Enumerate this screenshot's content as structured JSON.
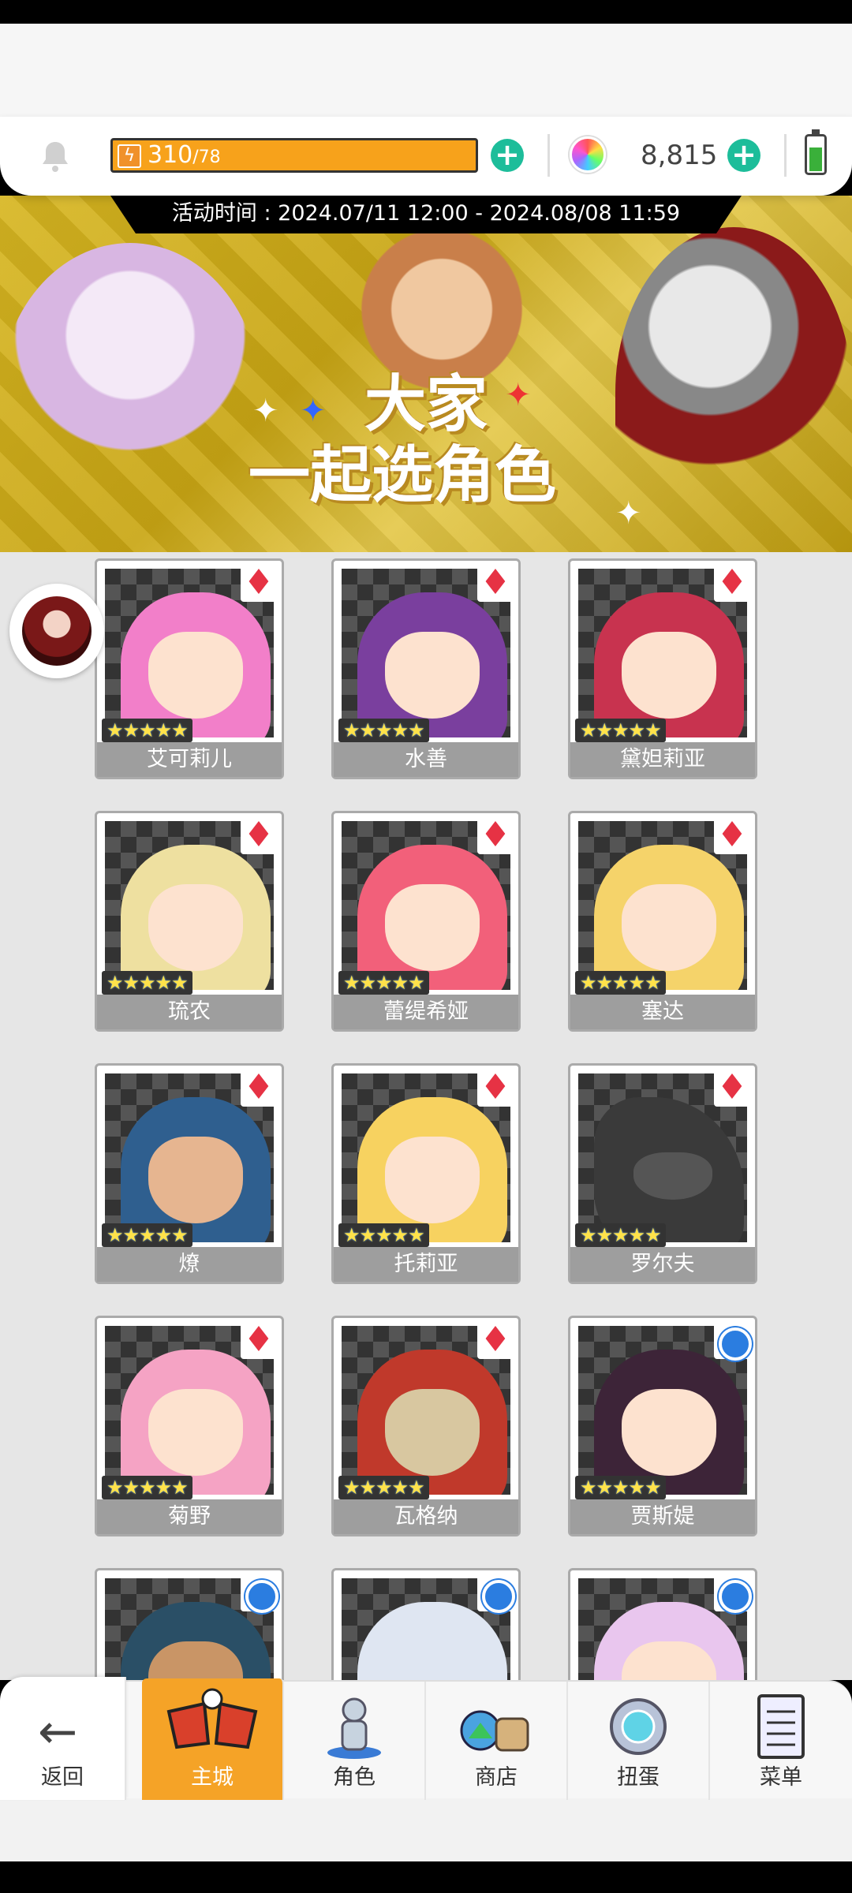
{
  "resources": {
    "stamina_current": "310",
    "stamina_max": "/78",
    "gems": "8,815"
  },
  "banner": {
    "event_time": "活动时间 : 2024.07/11 12:00 - 2024.08/08 11:59",
    "title_line1": "大家",
    "title_line2": "一起选角色"
  },
  "characters": [
    {
      "name": "艾可莉儿",
      "element": "fire-icon",
      "stars": "★★★★★"
    },
    {
      "name": "水善",
      "element": "fire-icon",
      "stars": "★★★★★"
    },
    {
      "name": "黛妲莉亚",
      "element": "fire-icon",
      "stars": "★★★★★"
    },
    {
      "name": "琉农",
      "element": "fire-icon",
      "stars": "★★★★★"
    },
    {
      "name": "蕾缇希娅",
      "element": "fire-icon",
      "stars": "★★★★★"
    },
    {
      "name": "塞达",
      "element": "fire-icon",
      "stars": "★★★★★"
    },
    {
      "name": "燎",
      "element": "fire-icon",
      "stars": "★★★★★"
    },
    {
      "name": "托莉亚",
      "element": "fire-icon",
      "stars": "★★★★★"
    },
    {
      "name": "罗尔夫",
      "element": "fire-icon",
      "stars": "★★★★★"
    },
    {
      "name": "菊野",
      "element": "fire-icon",
      "stars": "★★★★★"
    },
    {
      "name": "瓦格纳",
      "element": "fire-icon",
      "stars": "★★★★★"
    },
    {
      "name": "贾斯媞",
      "element": "water-icon",
      "stars": "★★★★★"
    }
  ],
  "nav": {
    "back": "返回",
    "castle": "主城",
    "character": "角色",
    "shop": "商店",
    "gacha": "扭蛋",
    "menu": "菜单"
  }
}
